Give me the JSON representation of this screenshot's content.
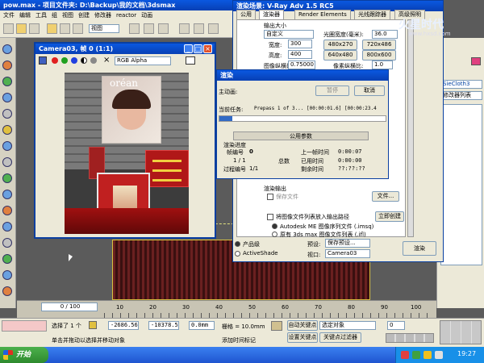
{
  "main_window": {
    "title": "pow.max - 项目文件夹: D:\\Backup\\我的文档\\3dsmax",
    "menu": [
      "文件",
      "编辑",
      "工具",
      "组",
      "视图",
      "创建",
      "修改器",
      "reactor",
      "动画"
    ],
    "view_dropdown": "视图"
  },
  "camera_window": {
    "title": "Camera03, 帧 0 (1:1)",
    "channel_dropdown": "RGB Alpha",
    "sign_text": "oréan"
  },
  "render_setup": {
    "title": "渲染场景: V-Ray Adv 1.5 RC5",
    "tabs": [
      "公用",
      "渲染器",
      "Render Elements",
      "光线跟踪器",
      "高级照明"
    ],
    "output_size_label": "输出大小",
    "output_size_value": "自定义",
    "aperture_label": "光圈宽度(毫米):",
    "aperture_value": "36.0",
    "width_label": "宽度:",
    "width_value": "300",
    "height_label": "高度:",
    "height_value": "400",
    "presets": [
      "480x270",
      "720x486",
      "640x480",
      "800x600"
    ],
    "image_aspect_label": "图像纵横比:",
    "image_aspect_value": "0.75000",
    "pixel_aspect_label": "像素纵横比:",
    "pixel_aspect_value": "1.0",
    "render_output_label": "渲染输出",
    "save_file_label": "保存文件",
    "files_button": "文件...",
    "put_images_label": "将图像文件列表放入输出路径",
    "create_now_button": "立即创建",
    "autodesk_label": "Autodesk ME 图像序列文件 (.imsq)",
    "legacy_label": "原有 3ds max 图像文件列表 (.ifl)",
    "production_label": "产品级",
    "activeshade_label": "ActiveShade",
    "preset_label": "预设:",
    "preset_value": "保存预设...",
    "viewport_label": "视口:",
    "viewport_value": "Camera03",
    "render_button": "渲染"
  },
  "render_progress": {
    "title": "渲染",
    "scene_label": "主动画:",
    "pause_button": "暂停",
    "cancel_button": "取消",
    "current_task_label": "当前任务:",
    "current_task_value": "Prepass 1 of 3... [00:00:01.6] [00:00:23.4",
    "progress_fraction": 0.08,
    "common_params_header": "公用参数",
    "render_progress_label": "渲染进度",
    "frame_label": "帧编号",
    "frame_value": "0",
    "frames_done": "1 / 1",
    "total_label": "总数",
    "pass_label": "过程编号",
    "pass_value": "1/1",
    "last_frame_time_label": "上一帧时间",
    "last_frame_time_value": "0:00:07",
    "elapsed_label": "已用时间",
    "elapsed_value": "0:00:00",
    "remaining_label": "剩余时间",
    "remaining_value": "??:??:??"
  },
  "right_panel": {
    "modifier_label": "SieCloth3",
    "modifier_list": "修改器列表"
  },
  "timeline": {
    "frame_counter": "0 / 100",
    "ticks": [
      "10",
      "20",
      "30",
      "40",
      "50",
      "60",
      "70",
      "80",
      "90",
      "100"
    ]
  },
  "status_bar": {
    "selection_label": "选择了 1 个",
    "x_value": "-2686.56",
    "y_value": "-10378.5",
    "z_value": "0.0mm",
    "grid_label": "栅格 = 10.0mm",
    "auto_key_button": "自动关键点",
    "selected_object_dropdown": "选定对象",
    "set_key_button": "设置关键点",
    "key_filters_button": "关键点过滤器",
    "frame_field": "0",
    "status_line1": "单击并拖动以选择并移动对象",
    "status_line2": "添加时间标记"
  },
  "taskbar": {
    "start_label": "开始",
    "clock": "19:27"
  },
  "watermark": {
    "line1": "火星时代",
    "line2": "www.hxsd.com"
  },
  "colors": {
    "xp_blue": "#0a58e0",
    "face": "#ece9d8",
    "viewport_bg": "#5b5b5b",
    "taskbar_green": "#3a9a3a",
    "progress_blue": "#316ac5"
  }
}
